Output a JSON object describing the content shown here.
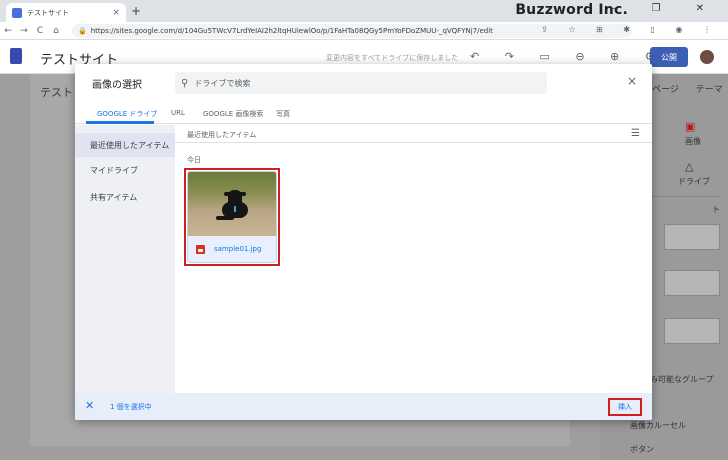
{
  "browser": {
    "tab_title": "テストサイト",
    "tab_close": "×",
    "new_tab": "+",
    "url": "https://sites.google.com/d/104Gu5TWcV7LrdYeIAI2h2ltqHUiewlOo/p/1FaHTa08QGy5PmYoFDoZMUU-_qVQFYNj7/edit",
    "brand": "Buzzword Inc.",
    "window_controls": "– ❐ ✕",
    "nav": {
      "back": "←",
      "forward": "→",
      "reload": "C",
      "home": "⌂"
    },
    "addr_icons": "⇪ ☆ ⊞ ✱ ▯ ◉ ⋮",
    "lock": "🔒"
  },
  "app": {
    "site_title": "テストサイト",
    "save_note": "変更内容をすべてドライブに保存しました",
    "toolbar_icons": "↶ ↷ ▭ ⊖ ⊕ ⚙ ⋮",
    "publish_label": "公開",
    "canvas_title": "テスト",
    "right_panel": {
      "tabs": "ページ テーマ",
      "image_label": "画像",
      "drive_label": "ドライブ",
      "layout_label": "ト",
      "collapsible_label": "たみ可能なグループ",
      "carousel_label": "画像カルーセル",
      "button_label": "ボタン"
    }
  },
  "dialog": {
    "title": "画像の選択",
    "search_placeholder": "ドライブで検索",
    "close": "×",
    "tabs": [
      {
        "label": "GOOGLE ドライブ",
        "active": true
      },
      {
        "label": "URL",
        "active": false
      },
      {
        "label": "GOOGLE 画像検索",
        "active": false
      },
      {
        "label": "写真",
        "active": false
      }
    ],
    "sidebar": [
      {
        "label": "最近使用したアイテム",
        "selected": true
      },
      {
        "label": "マイドライブ",
        "selected": false
      },
      {
        "label": "共有アイテム",
        "selected": false
      }
    ],
    "content_header": "最近使用したアイテム",
    "group_label": "今日",
    "files": [
      {
        "name": "sample01.jpg",
        "selected": true
      }
    ],
    "footer": {
      "deselect": "✕",
      "selected_count": "1 個を選択中",
      "insert_label": "挿入"
    }
  },
  "colors": {
    "accent": "#1a73e8",
    "highlight_border": "#d01f1f",
    "publish_button": "#3c5fb4"
  }
}
